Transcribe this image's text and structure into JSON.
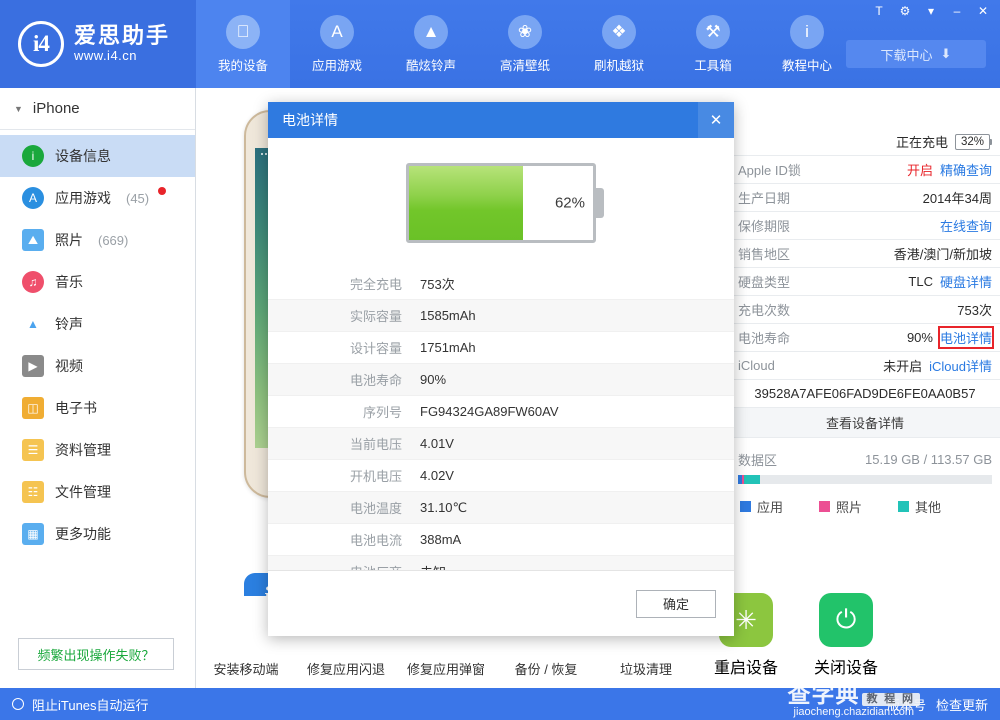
{
  "app": {
    "brand_name": "爱思助手",
    "brand_url": "www.i4.cn",
    "logo_mark": "i4",
    "accent": "#3b76e8",
    "download_center": "下载中心"
  },
  "titlebar": {
    "buttons": [
      {
        "name": "skin-icon",
        "glyph": "T"
      },
      {
        "name": "settings-gear-icon",
        "glyph": "⚙"
      },
      {
        "name": "menu-chevron-down-icon",
        "glyph": "▾"
      },
      {
        "name": "minimize-icon",
        "glyph": "–"
      },
      {
        "name": "close-icon",
        "glyph": "✕"
      }
    ]
  },
  "nav": {
    "items": [
      {
        "label": "我的设备",
        "icon": "apple-icon",
        "glyph": "",
        "active": true
      },
      {
        "label": "应用游戏",
        "icon": "appstore-icon",
        "glyph": "A",
        "active": false
      },
      {
        "label": "酷炫铃声",
        "icon": "bell-icon",
        "glyph": "▲",
        "active": false
      },
      {
        "label": "高清壁纸",
        "icon": "flower-wallpaper-icon",
        "glyph": "❀",
        "active": false
      },
      {
        "label": "刷机越狱",
        "icon": "dropbox-flash-icon",
        "glyph": "❖",
        "active": false
      },
      {
        "label": "工具箱",
        "icon": "tools-icon",
        "glyph": "⚒",
        "active": false
      },
      {
        "label": "教程中心",
        "icon": "info-italic-icon",
        "glyph": "i",
        "active": false
      }
    ]
  },
  "sidebar": {
    "device_name": "iPhone",
    "items": [
      {
        "label": "设备信息",
        "icon": "info-circle-icon",
        "glyph": "i",
        "color": "#1aa83c",
        "shape": "circle",
        "count": "",
        "dot": false,
        "active": true
      },
      {
        "label": "应用游戏",
        "icon": "appstore-icon",
        "glyph": "A",
        "color": "#2a8fe0",
        "shape": "circle",
        "count": "(45)",
        "dot": true,
        "active": false
      },
      {
        "label": "照片",
        "icon": "photo-icon",
        "glyph": "⛰",
        "color": "#5aaeef",
        "shape": "square",
        "count": "(669)",
        "dot": false,
        "active": false
      },
      {
        "label": "音乐",
        "icon": "music-note-icon",
        "glyph": "♫",
        "color": "#ef4f6b",
        "shape": "circle",
        "count": "",
        "dot": false,
        "active": false
      },
      {
        "label": "铃声",
        "icon": "bell-icon",
        "glyph": "▲",
        "color": "#ffffff",
        "shape": "bell",
        "count": "",
        "dot": false,
        "active": false
      },
      {
        "label": "视频",
        "icon": "video-film-icon",
        "glyph": "▶",
        "color": "#8a8a8a",
        "shape": "square",
        "count": "",
        "dot": false,
        "active": false
      },
      {
        "label": "电子书",
        "icon": "book-icon",
        "glyph": "◫",
        "color": "#f0ad33",
        "shape": "square",
        "count": "",
        "dot": false,
        "active": false
      },
      {
        "label": "资料管理",
        "icon": "contacts-icon",
        "glyph": "☰",
        "color": "#f5c451",
        "shape": "square",
        "count": "",
        "dot": false,
        "active": false
      },
      {
        "label": "文件管理",
        "icon": "files-icon",
        "glyph": "☷",
        "color": "#f5c451",
        "shape": "square",
        "count": "",
        "dot": false,
        "active": false
      },
      {
        "label": "更多功能",
        "icon": "grid-more-icon",
        "glyph": "▦",
        "color": "#5aaeef",
        "shape": "square",
        "count": "",
        "dot": false,
        "active": false
      }
    ],
    "fail_button": "频繁出现操作失败？"
  },
  "device_info": {
    "rows": [
      {
        "label": "",
        "value": "正在充电",
        "battery": "32%",
        "type": "battery"
      },
      {
        "label": "Apple ID锁",
        "value": "开启",
        "value_color": "red",
        "link": "精确查询"
      },
      {
        "label": "生产日期",
        "value": "2014年34周",
        "link": ""
      },
      {
        "label": "保修期限",
        "value": "",
        "link": "在线查询"
      },
      {
        "label": "销售地区",
        "value": "香港/澳门/新加坡",
        "link": ""
      },
      {
        "label": "硬盘类型",
        "value": "TLC",
        "link": "硬盘详情"
      },
      {
        "label": "充电次数",
        "value": "753次",
        "link": ""
      },
      {
        "label": "电池寿命",
        "value": "90%",
        "link": "电池详情",
        "link_highlight": true
      },
      {
        "label": "iCloud",
        "value": "未开启",
        "link": "iCloud详情"
      }
    ],
    "udid": "39528A7AFE06FAD9DE6FE0AA0B57",
    "view_details": "查看设备详情",
    "storage_label": "数据区",
    "storage_value": "15.19 GB / 113.57 GB",
    "storage_segments": [
      {
        "name": "应用",
        "color": "#2f7ae0",
        "percent": 1.5
      },
      {
        "name": "照片",
        "color": "#ec4f93",
        "percent": 1.0
      },
      {
        "name": "其他",
        "color": "#22c3b8",
        "percent": 6.0
      }
    ],
    "legend": [
      {
        "label": "应用",
        "color": "#2f7ae0"
      },
      {
        "label": "照片",
        "color": "#ec4f93"
      },
      {
        "label": "其他",
        "color": "#22c3b8"
      }
    ]
  },
  "toolbar": {
    "text_tools": [
      "安装移动端",
      "修复应用闪退",
      "修复应用弹窗",
      "备份 / 恢复",
      "垃圾清理"
    ],
    "big_tools": [
      {
        "label": "重启设备",
        "icon": "restart-icon",
        "color": "#8cc63f",
        "glyph": "✳"
      },
      {
        "label": "关闭设备",
        "icon": "power-off-icon",
        "color": "#22c36a",
        "glyph": "⏻"
      }
    ]
  },
  "statusbar": {
    "block_itunes": "阻止iTunes自动运行",
    "version_label": "版本号",
    "check_update": "检查更新"
  },
  "watermark": {
    "main": "查字典",
    "tag": "教 程 网",
    "sub": "jiaocheng.chazidian.com"
  },
  "modal": {
    "title": "电池详情",
    "close_glyph": "✕",
    "battery_percent_label": "62%",
    "battery_percent_value": 62,
    "rows": [
      {
        "label": "完全充电",
        "value": "753次"
      },
      {
        "label": "实际容量",
        "value": "1585mAh"
      },
      {
        "label": "设计容量",
        "value": "1751mAh"
      },
      {
        "label": "电池寿命",
        "value": "90%"
      },
      {
        "label": "序列号",
        "value": "FG94324GA89FW60AV"
      },
      {
        "label": "当前电压",
        "value": "4.01V"
      },
      {
        "label": "开机电压",
        "value": "4.02V"
      },
      {
        "label": "电池温度",
        "value": "31.10℃"
      },
      {
        "label": "电池电流",
        "value": "388mA"
      },
      {
        "label": "电池厂商",
        "value": "未知"
      }
    ],
    "ok_label": "确定"
  }
}
